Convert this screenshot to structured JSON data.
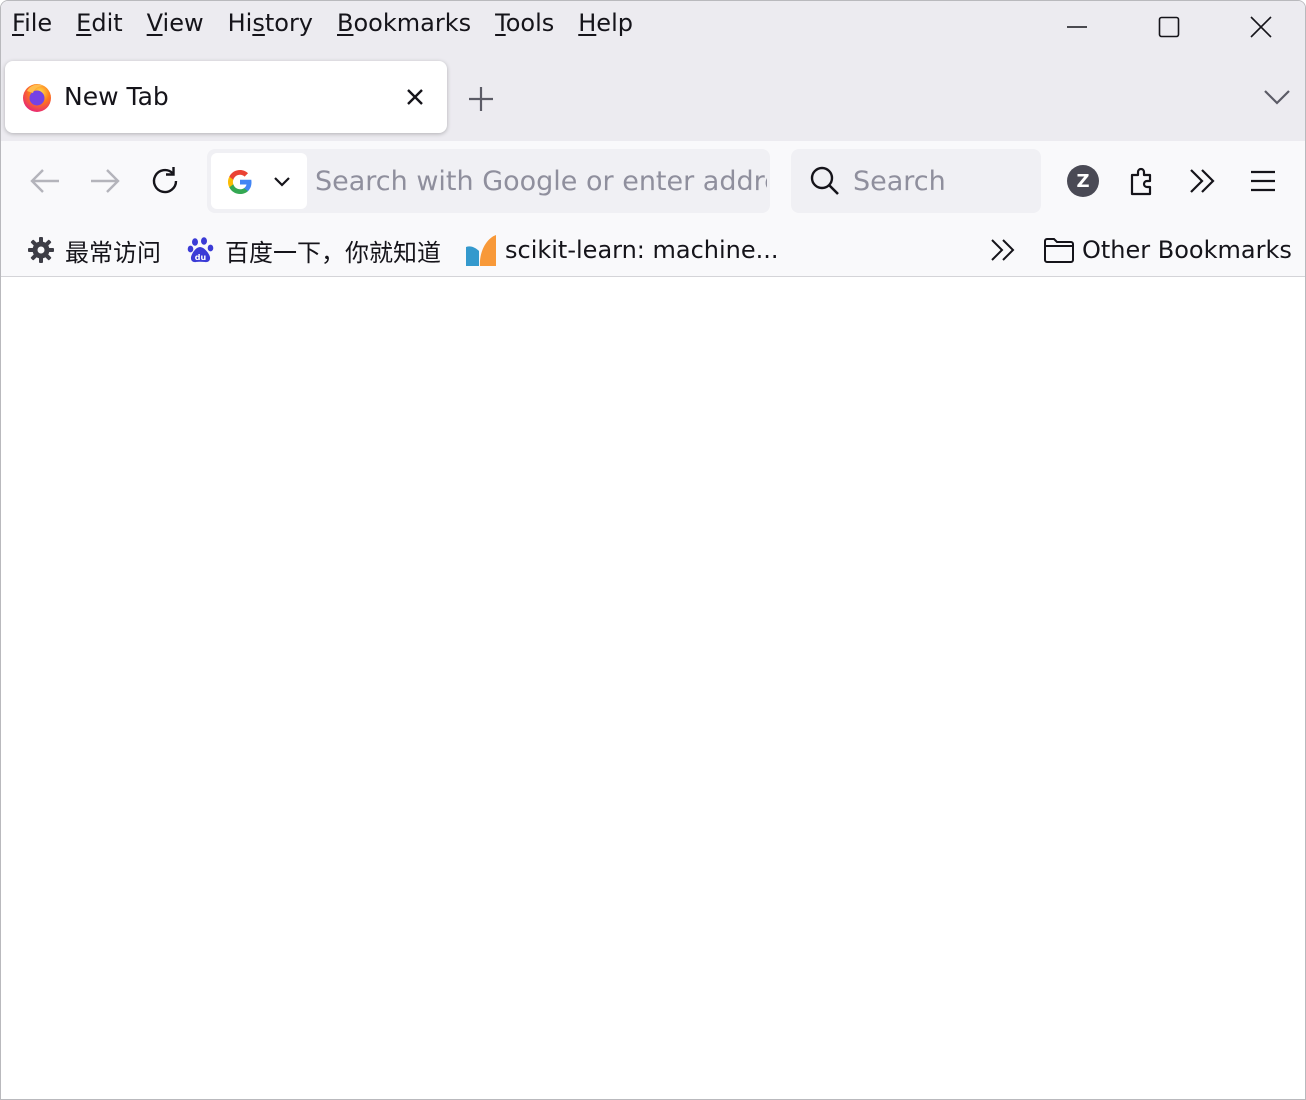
{
  "menu": {
    "file": {
      "mnemonic": "F",
      "rest": "ile"
    },
    "edit": {
      "mnemonic": "E",
      "rest": "dit"
    },
    "view": {
      "mnemonic": "V",
      "rest": "iew"
    },
    "history": {
      "pre": "Hi",
      "mnemonic": "s",
      "rest": "tory"
    },
    "bookmarks": {
      "mnemonic": "B",
      "rest": "ookmarks"
    },
    "tools": {
      "mnemonic": "T",
      "rest": "ools"
    },
    "help": {
      "mnemonic": "H",
      "rest": "elp"
    }
  },
  "tab": {
    "title": "New Tab",
    "favicon": "firefox-icon"
  },
  "urlbar": {
    "placeholder": "Search with Google or enter address",
    "engine_icon": "google-icon"
  },
  "searchbar": {
    "placeholder": "Search"
  },
  "account": {
    "initial": "Z",
    "color": "#4a4a55"
  },
  "bookmarks": {
    "items": [
      {
        "label": "最常访问",
        "icon": "gear-icon"
      },
      {
        "label": "百度一下，你就知道",
        "icon": "baidu-paw-icon"
      },
      {
        "label": "scikit-learn: machine...",
        "icon": "scikit-learn-icon"
      }
    ],
    "other_label": "Other Bookmarks"
  },
  "colors": {
    "titlebar_bg": "#ecebf0",
    "toolbar_bg": "#f9f9fb",
    "field_bg": "#f0f0f4",
    "text": "#15141a",
    "placeholder": "#8f8f9d"
  }
}
